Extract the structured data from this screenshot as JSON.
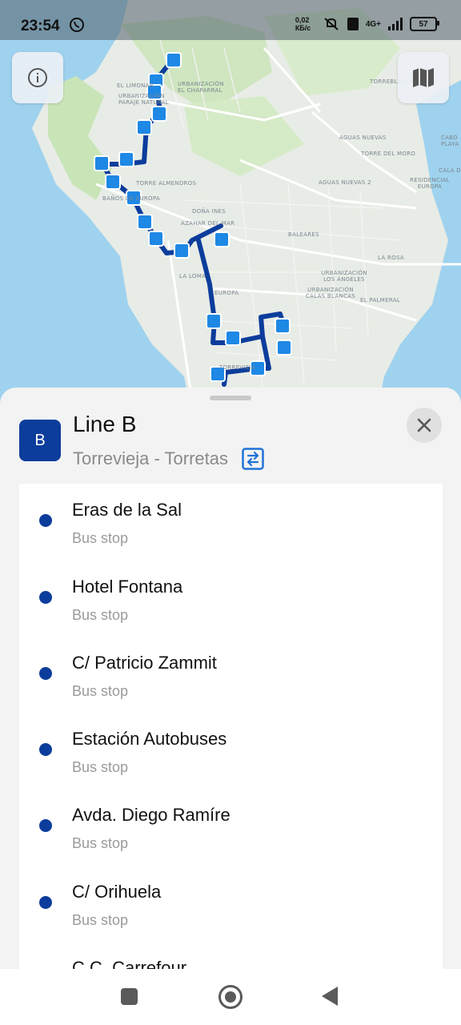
{
  "status_bar": {
    "time": "23:54",
    "network_speed": "0,02 КБ/с",
    "network_type": "4G+",
    "battery": "57"
  },
  "map": {
    "labels": [
      "EL LIMONAR",
      "URBANIZACIÓN EL CHAPARRAL",
      "URBANIZACIÓN PARAJE NATURAL",
      "TORRE ALMENDROS",
      "BAÑOS DE EUROPA",
      "DOÑA INES",
      "AZAHAR DEL MAR",
      "LA LOMA",
      "EUROPA",
      "BALEARES",
      "AGUAS NUEVAS",
      "AGUAS NUEVAS 2",
      "TORRE DEL MORO",
      "TORREBLANCA",
      "URBANIZACIÓN LOS ÁNGELES",
      "URBANIZACIÓN CALAS BLANCAS",
      "EL PALMERAL",
      "LA ROSA",
      "RESIDENCIAL EUROPA",
      "CABO PLAYA",
      "CALA DE",
      "TORREVIEJA"
    ],
    "info_icon": "info-icon",
    "map_icon": "map-icon",
    "route_color": "#0c3d9c",
    "stop_color": "#1e88e5"
  },
  "line": {
    "badge": "B",
    "title": "Line B",
    "route": "Torrevieja - Torretas",
    "swap_icon": "swap-direction-icon",
    "close_icon": "close-icon"
  },
  "stops": [
    {
      "name": "Eras de la Sal",
      "type": "Bus stop"
    },
    {
      "name": "Hotel Fontana",
      "type": "Bus stop"
    },
    {
      "name": "C/ Patricio Zammit",
      "type": "Bus stop"
    },
    {
      "name": "Estación Autobuses",
      "type": "Bus stop"
    },
    {
      "name": "Avda. Diego Ramíre",
      "type": "Bus stop"
    },
    {
      "name": "C/ Orihuela",
      "type": "Bus stop"
    },
    {
      "name": "C.C. Carrefour",
      "type": "Bus stop"
    }
  ],
  "nav": {
    "recents_icon": "recents-icon",
    "home_icon": "home-icon",
    "back_icon": "back-icon"
  }
}
